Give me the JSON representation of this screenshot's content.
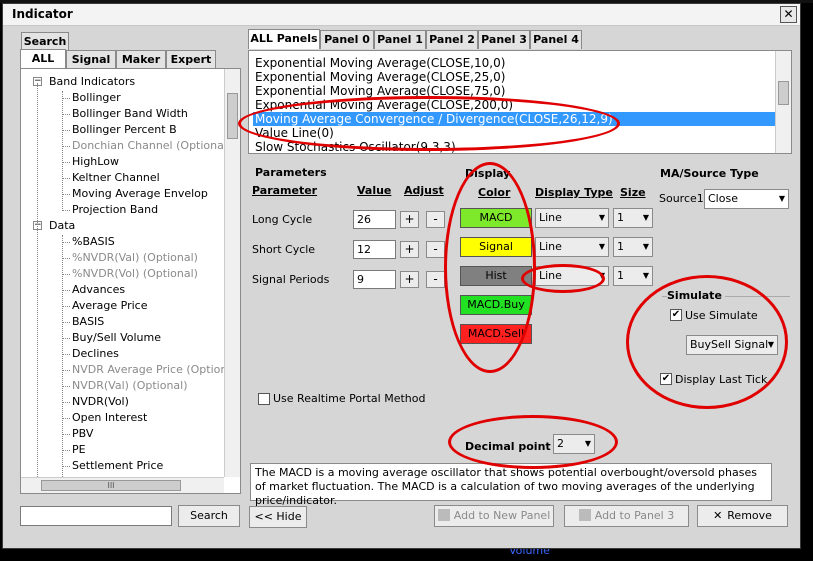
{
  "window": {
    "title": "Indicator",
    "close_glyph": "✕"
  },
  "left_tabs": {
    "search": "Search",
    "all": "ALL",
    "signal": "Signal",
    "maker": "Maker",
    "expert": "Expert"
  },
  "tree": {
    "band_group": "Band Indicators",
    "band_items": [
      {
        "label": "Bollinger",
        "disabled": false
      },
      {
        "label": "Bollinger Band Width",
        "disabled": false
      },
      {
        "label": "Bollinger Percent B",
        "disabled": false
      },
      {
        "label": "Donchian Channel (Optional)",
        "disabled": true
      },
      {
        "label": "HighLow",
        "disabled": false
      },
      {
        "label": "Keltner Channel",
        "disabled": false
      },
      {
        "label": "Moving Average Envelop",
        "disabled": false
      },
      {
        "label": "Projection Band",
        "disabled": false
      }
    ],
    "data_group": "Data",
    "data_items": [
      {
        "label": "%BASIS",
        "disabled": false
      },
      {
        "label": "%NVDR(Val) (Optional)",
        "disabled": true
      },
      {
        "label": "%NVDR(Vol) (Optional)",
        "disabled": true
      },
      {
        "label": "Advances",
        "disabled": false
      },
      {
        "label": "Average Price",
        "disabled": false
      },
      {
        "label": "BASIS",
        "disabled": false
      },
      {
        "label": "Buy/Sell Volume",
        "disabled": false
      },
      {
        "label": "Declines",
        "disabled": false
      },
      {
        "label": "NVDR Average Price (Optional)",
        "disabled": true
      },
      {
        "label": "NVDR(Val) (Optional)",
        "disabled": true
      },
      {
        "label": "NVDR(Vol)",
        "disabled": false
      },
      {
        "label": "Open Interest",
        "disabled": false
      },
      {
        "label": "PBV",
        "disabled": false
      },
      {
        "label": "PE",
        "disabled": false
      },
      {
        "label": "Settlement Price",
        "disabled": false
      }
    ],
    "collapse_glyph": "−",
    "hscroll_glyph": "III"
  },
  "search": {
    "value": "",
    "button": "Search"
  },
  "panel_tabs": [
    "ALL Panels",
    "Panel 0",
    "Panel 1",
    "Panel 2",
    "Panel 3",
    "Panel 4"
  ],
  "indicator_list": [
    "Exponential Moving Average(CLOSE,10,0)",
    "Exponential Moving Average(CLOSE,25,0)",
    "Exponential Moving Average(CLOSE,75,0)",
    "Exponential Moving Average(CLOSE,200,0)",
    "Moving Average Convergence / Divergence(CLOSE,26,12,9)",
    "Value Line(0)",
    "Slow Stochastics Oscillator(9,3,3)"
  ],
  "selected_index": 4,
  "parameters": {
    "section": "Parameters",
    "col_parameter": "Parameter",
    "col_value": "Value",
    "col_adjust": "Adjust",
    "rows": [
      {
        "name": "Long Cycle",
        "value": "26"
      },
      {
        "name": "Short Cycle",
        "value": "12"
      },
      {
        "name": "Signal Periods",
        "value": "9"
      }
    ],
    "plus": "+",
    "minus": "-"
  },
  "display": {
    "section": "Display",
    "col_color": "Color",
    "col_type": "Display Type",
    "col_size": "Size",
    "rows": [
      {
        "label": "MACD",
        "color": "#7ee82a",
        "type": "Line",
        "size": "1"
      },
      {
        "label": "Signal",
        "color": "#ffff00",
        "type": "Line",
        "size": "1"
      },
      {
        "label": "Hist",
        "color": "#808080",
        "type": "Line",
        "size": "1"
      },
      {
        "label": "MACD.Buy",
        "color": "#22e022",
        "type": "",
        "size": ""
      },
      {
        "label": "MACD.Sell",
        "color": "#ff2020",
        "type": "",
        "size": ""
      }
    ]
  },
  "ma_source": {
    "section": "MA/Source Type",
    "label": "Source1",
    "value": "Close"
  },
  "simulate": {
    "section": "Simulate",
    "use_simulate": "Use Simulate",
    "use_checked": true,
    "mode": "BuySell Signal",
    "display_last_tick": "Display Last Tick",
    "last_checked": true
  },
  "realtime": {
    "label": "Use Realtime Portal Method",
    "checked": false
  },
  "decimal": {
    "label": "Decimal point",
    "value": "2"
  },
  "description": "The MACD is a moving average oscillator that shows potential overbought/oversold phases of market fluctuation. The MACD is a calculation of two moving averages of the underlying price/indicator.",
  "buttons": {
    "hide": "<< Hide",
    "add_new": "Add to New Panel",
    "add_panel": "Add to Panel 3",
    "remove": "Remove"
  },
  "background_label": "Volume",
  "colors": {
    "selection": "#3399ff",
    "annotation": "#e00000"
  }
}
